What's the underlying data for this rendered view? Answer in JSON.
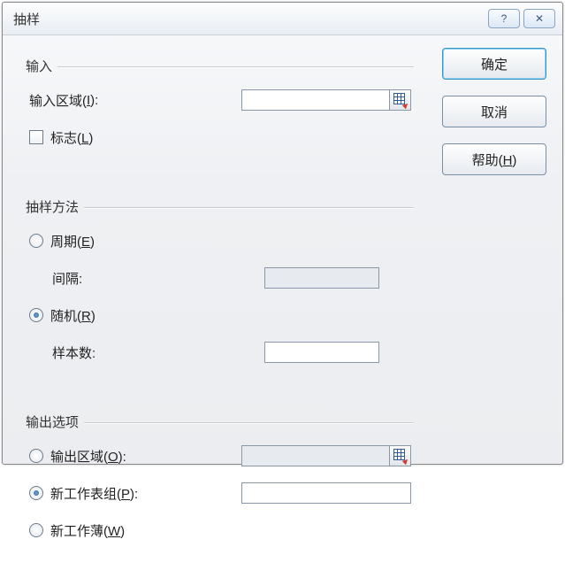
{
  "title": "抽样",
  "titlebar": {
    "help": "?",
    "close": "✕"
  },
  "buttons": {
    "ok": "确定",
    "cancel": "取消",
    "help": "帮助(H)"
  },
  "input_group": {
    "header": "输入",
    "range_label_pre": "输入区域(",
    "range_label_ul": "I",
    "range_label_post": "):",
    "range_value": "",
    "labels_pre": "标志(",
    "labels_ul": "L",
    "labels_post": ")",
    "labels_checked": false
  },
  "method_group": {
    "header": "抽样方法",
    "periodic_pre": "周期(",
    "periodic_ul": "E",
    "periodic_post": ")",
    "periodic_selected": false,
    "interval_label": "间隔:",
    "interval_value": "",
    "random_pre": "随机(",
    "random_ul": "R",
    "random_post": ")",
    "random_selected": true,
    "samples_label": "样本数:",
    "samples_value": ""
  },
  "output_group": {
    "header": "输出选项",
    "range_pre": "输出区域(",
    "range_ul": "O",
    "range_post": "):",
    "range_selected": false,
    "range_value": "",
    "newsheet_pre": "新工作表组(",
    "newsheet_ul": "P",
    "newsheet_post": "):",
    "newsheet_selected": true,
    "newsheet_value": "",
    "newbook_pre": "新工作薄(",
    "newbook_ul": "W",
    "newbook_post": ")",
    "newbook_selected": false
  }
}
